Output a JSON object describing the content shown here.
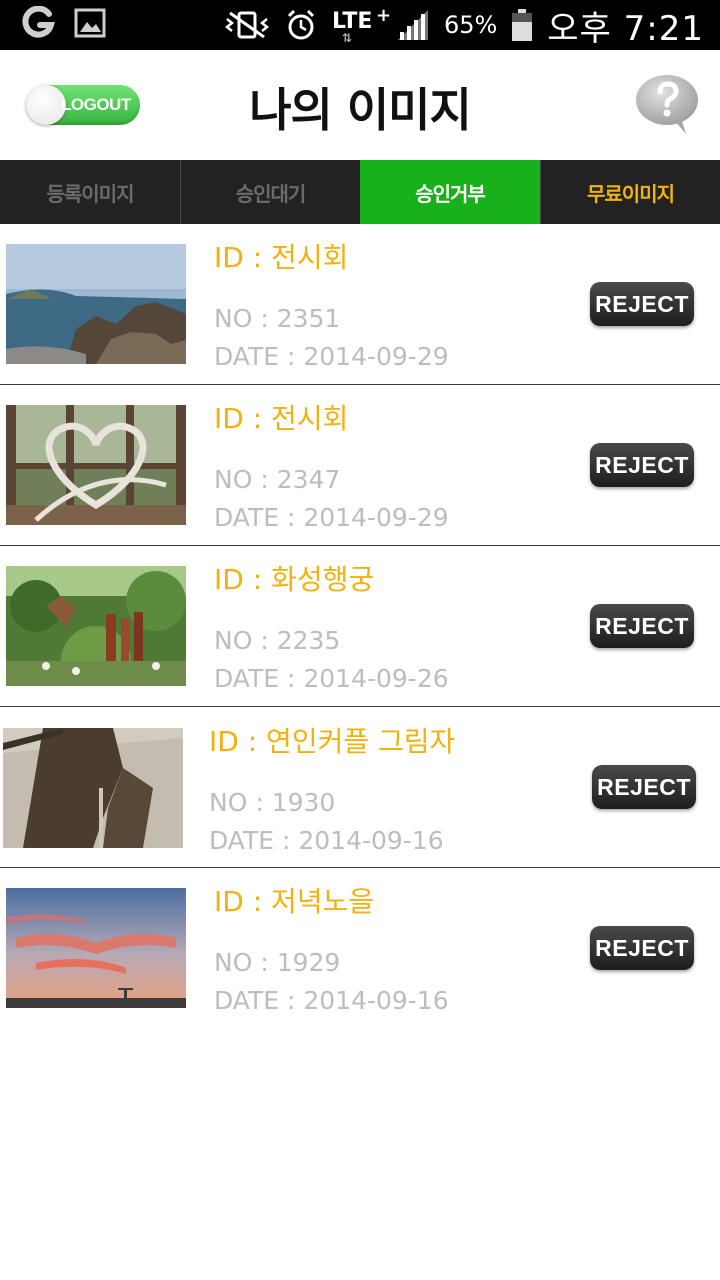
{
  "status_bar": {
    "left_icons": [
      "carrier-g-icon",
      "gallery-icon"
    ],
    "right_icons": [
      "vibrate-mute-icon",
      "alarm-icon",
      "signal-icon",
      "battery-icon"
    ],
    "network": "LTE",
    "network_plus": "+",
    "battery_percent": "65%",
    "time": "오후 7:21"
  },
  "header": {
    "logout_label": "LOGOUT",
    "title": "나의 이미지",
    "help_icon": "question-icon"
  },
  "tabs": [
    {
      "label": "등록이미지",
      "active": false
    },
    {
      "label": "승인대기",
      "active": false
    },
    {
      "label": "승인거부",
      "active": true
    },
    {
      "label": "무료이미지",
      "active": false
    }
  ],
  "colors": {
    "accent_green": "#19b11a",
    "tab_bar": "#222222",
    "id_text": "#f4b00c",
    "meta_text": "#bdbdbd",
    "free_tab_text": "#f3b40a"
  },
  "items": [
    {
      "id": "ID : 전시회",
      "no": "NO : 2351",
      "date": "DATE : 2014-09-29",
      "button": "REJECT"
    },
    {
      "id": "ID : 전시회",
      "no": "NO : 2347",
      "date": "DATE : 2014-09-29",
      "button": "REJECT"
    },
    {
      "id": "ID : 화성행궁",
      "no": "NO : 2235",
      "date": "DATE : 2014-09-26",
      "button": "REJECT"
    },
    {
      "id": "ID : 연인커플 그림자",
      "no": "NO : 1930",
      "date": "DATE : 2014-09-16",
      "button": "REJECT"
    },
    {
      "id": "ID : 저녁노을",
      "no": "NO : 1929",
      "date": "DATE : 2014-09-16",
      "button": "REJECT"
    }
  ]
}
